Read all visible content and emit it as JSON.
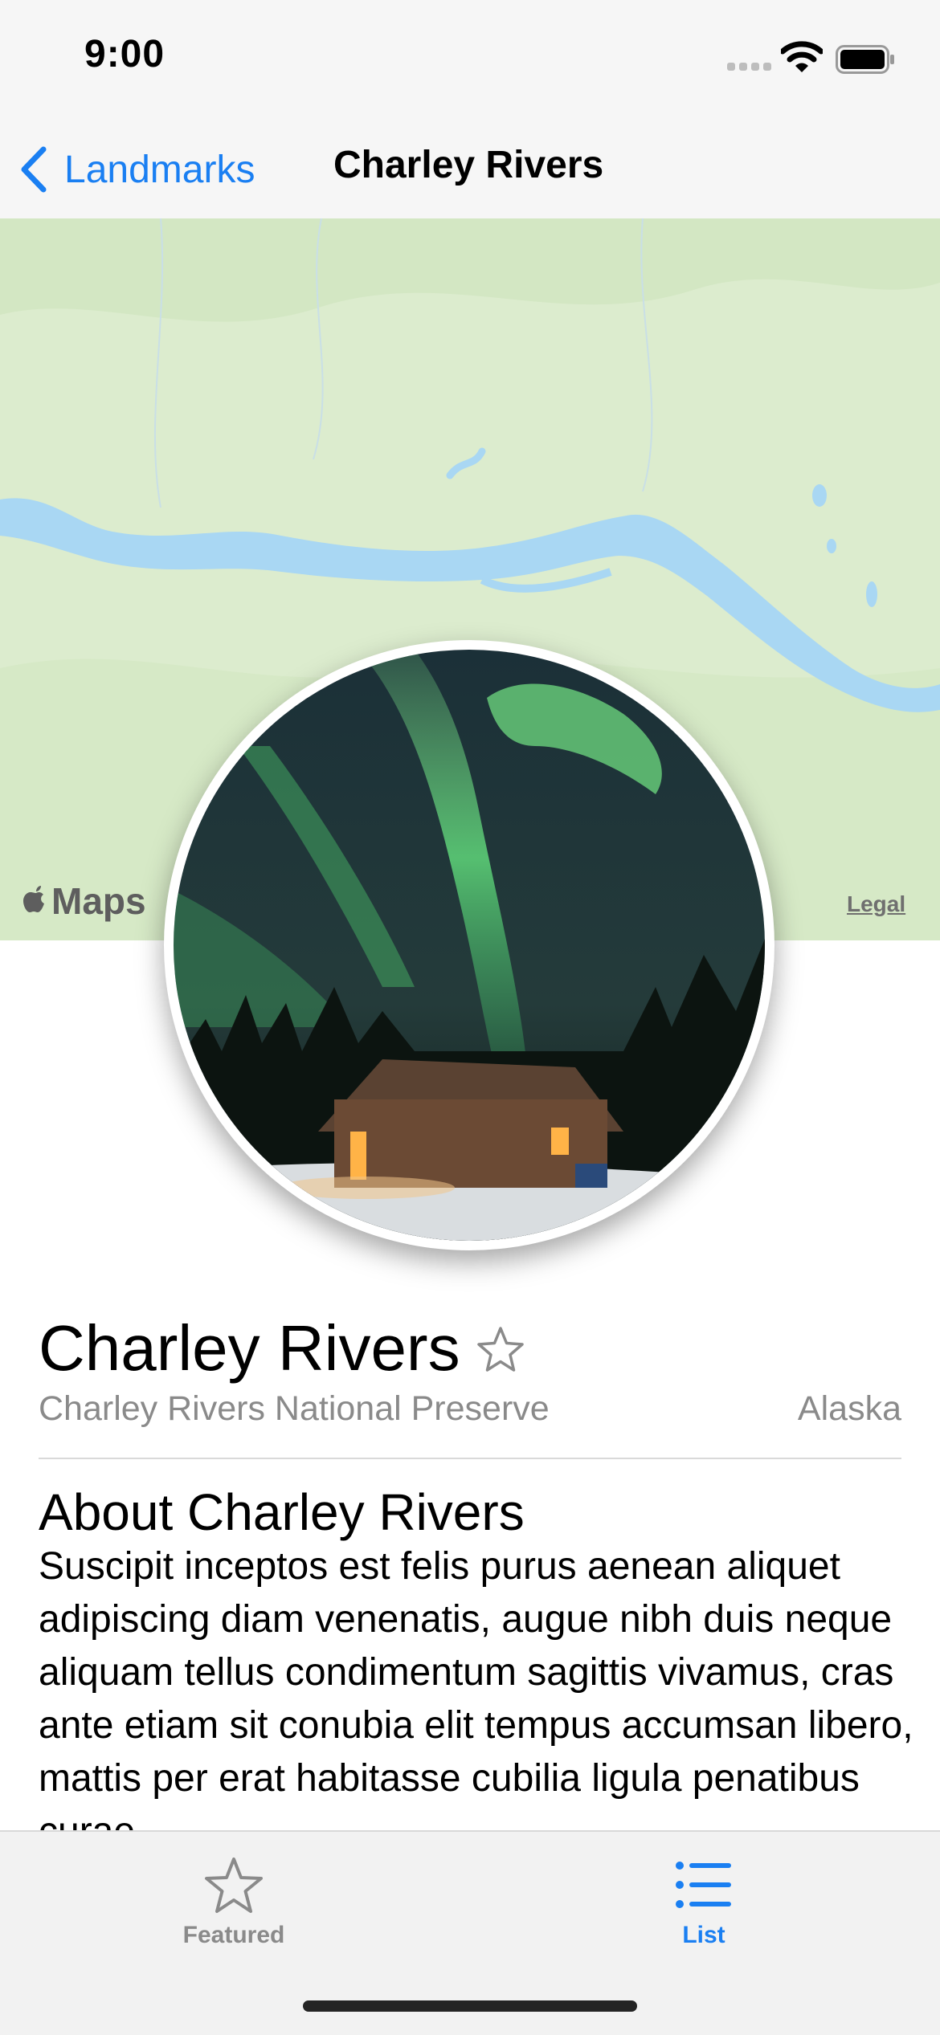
{
  "status_bar": {
    "time": "9:00"
  },
  "nav": {
    "back_label": "Landmarks",
    "title": "Charley Rivers"
  },
  "map": {
    "brand": "Maps",
    "legal": "Legal"
  },
  "landmark": {
    "name": "Charley Rivers",
    "park": "Charley Rivers National Preserve",
    "state": "Alaska",
    "favorite": false
  },
  "about": {
    "title": "About Charley Rivers",
    "body": "Suscipit inceptos est felis purus aenean aliquet adipiscing diam venenatis, augue nibh duis neque aliquam tellus condimentum sagittis vivamus, cras ante etiam sit conubia elit tempus accumsan libero, mattis per erat habitasse cubilia ligula penatibus curae."
  },
  "tabs": [
    {
      "label": "Featured",
      "icon": "star-icon",
      "selected": false
    },
    {
      "label": "List",
      "icon": "list-icon",
      "selected": true
    }
  ],
  "colors": {
    "accent": "#1a7ff2",
    "map_land": "#dcecce",
    "map_water": "#a9d7f3",
    "secondary_text": "#8a8a8a"
  }
}
